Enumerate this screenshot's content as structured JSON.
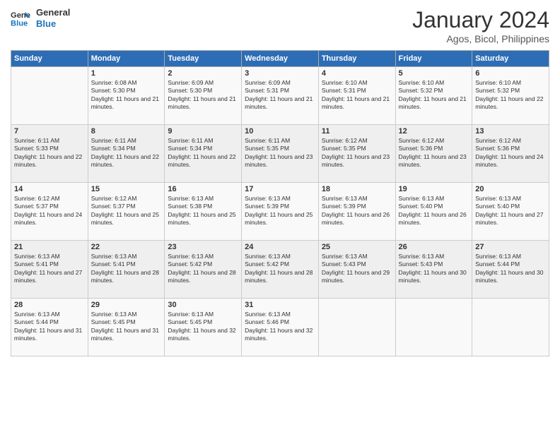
{
  "logo": {
    "line1": "General",
    "line2": "Blue"
  },
  "title": "January 2024",
  "subtitle": "Agos, Bicol, Philippines",
  "days_of_week": [
    "Sunday",
    "Monday",
    "Tuesday",
    "Wednesday",
    "Thursday",
    "Friday",
    "Saturday"
  ],
  "weeks": [
    [
      {
        "day": "",
        "sunrise": "",
        "sunset": "",
        "daylight": ""
      },
      {
        "day": "1",
        "sunrise": "Sunrise: 6:08 AM",
        "sunset": "Sunset: 5:30 PM",
        "daylight": "Daylight: 11 hours and 21 minutes."
      },
      {
        "day": "2",
        "sunrise": "Sunrise: 6:09 AM",
        "sunset": "Sunset: 5:30 PM",
        "daylight": "Daylight: 11 hours and 21 minutes."
      },
      {
        "day": "3",
        "sunrise": "Sunrise: 6:09 AM",
        "sunset": "Sunset: 5:31 PM",
        "daylight": "Daylight: 11 hours and 21 minutes."
      },
      {
        "day": "4",
        "sunrise": "Sunrise: 6:10 AM",
        "sunset": "Sunset: 5:31 PM",
        "daylight": "Daylight: 11 hours and 21 minutes."
      },
      {
        "day": "5",
        "sunrise": "Sunrise: 6:10 AM",
        "sunset": "Sunset: 5:32 PM",
        "daylight": "Daylight: 11 hours and 21 minutes."
      },
      {
        "day": "6",
        "sunrise": "Sunrise: 6:10 AM",
        "sunset": "Sunset: 5:32 PM",
        "daylight": "Daylight: 11 hours and 22 minutes."
      }
    ],
    [
      {
        "day": "7",
        "sunrise": "Sunrise: 6:11 AM",
        "sunset": "Sunset: 5:33 PM",
        "daylight": "Daylight: 11 hours and 22 minutes."
      },
      {
        "day": "8",
        "sunrise": "Sunrise: 6:11 AM",
        "sunset": "Sunset: 5:34 PM",
        "daylight": "Daylight: 11 hours and 22 minutes."
      },
      {
        "day": "9",
        "sunrise": "Sunrise: 6:11 AM",
        "sunset": "Sunset: 5:34 PM",
        "daylight": "Daylight: 11 hours and 22 minutes."
      },
      {
        "day": "10",
        "sunrise": "Sunrise: 6:11 AM",
        "sunset": "Sunset: 5:35 PM",
        "daylight": "Daylight: 11 hours and 23 minutes."
      },
      {
        "day": "11",
        "sunrise": "Sunrise: 6:12 AM",
        "sunset": "Sunset: 5:35 PM",
        "daylight": "Daylight: 11 hours and 23 minutes."
      },
      {
        "day": "12",
        "sunrise": "Sunrise: 6:12 AM",
        "sunset": "Sunset: 5:36 PM",
        "daylight": "Daylight: 11 hours and 23 minutes."
      },
      {
        "day": "13",
        "sunrise": "Sunrise: 6:12 AM",
        "sunset": "Sunset: 5:36 PM",
        "daylight": "Daylight: 11 hours and 24 minutes."
      }
    ],
    [
      {
        "day": "14",
        "sunrise": "Sunrise: 6:12 AM",
        "sunset": "Sunset: 5:37 PM",
        "daylight": "Daylight: 11 hours and 24 minutes."
      },
      {
        "day": "15",
        "sunrise": "Sunrise: 6:12 AM",
        "sunset": "Sunset: 5:37 PM",
        "daylight": "Daylight: 11 hours and 25 minutes."
      },
      {
        "day": "16",
        "sunrise": "Sunrise: 6:13 AM",
        "sunset": "Sunset: 5:38 PM",
        "daylight": "Daylight: 11 hours and 25 minutes."
      },
      {
        "day": "17",
        "sunrise": "Sunrise: 6:13 AM",
        "sunset": "Sunset: 5:39 PM",
        "daylight": "Daylight: 11 hours and 25 minutes."
      },
      {
        "day": "18",
        "sunrise": "Sunrise: 6:13 AM",
        "sunset": "Sunset: 5:39 PM",
        "daylight": "Daylight: 11 hours and 26 minutes."
      },
      {
        "day": "19",
        "sunrise": "Sunrise: 6:13 AM",
        "sunset": "Sunset: 5:40 PM",
        "daylight": "Daylight: 11 hours and 26 minutes."
      },
      {
        "day": "20",
        "sunrise": "Sunrise: 6:13 AM",
        "sunset": "Sunset: 5:40 PM",
        "daylight": "Daylight: 11 hours and 27 minutes."
      }
    ],
    [
      {
        "day": "21",
        "sunrise": "Sunrise: 6:13 AM",
        "sunset": "Sunset: 5:41 PM",
        "daylight": "Daylight: 11 hours and 27 minutes."
      },
      {
        "day": "22",
        "sunrise": "Sunrise: 6:13 AM",
        "sunset": "Sunset: 5:41 PM",
        "daylight": "Daylight: 11 hours and 28 minutes."
      },
      {
        "day": "23",
        "sunrise": "Sunrise: 6:13 AM",
        "sunset": "Sunset: 5:42 PM",
        "daylight": "Daylight: 11 hours and 28 minutes."
      },
      {
        "day": "24",
        "sunrise": "Sunrise: 6:13 AM",
        "sunset": "Sunset: 5:42 PM",
        "daylight": "Daylight: 11 hours and 28 minutes."
      },
      {
        "day": "25",
        "sunrise": "Sunrise: 6:13 AM",
        "sunset": "Sunset: 5:43 PM",
        "daylight": "Daylight: 11 hours and 29 minutes."
      },
      {
        "day": "26",
        "sunrise": "Sunrise: 6:13 AM",
        "sunset": "Sunset: 5:43 PM",
        "daylight": "Daylight: 11 hours and 30 minutes."
      },
      {
        "day": "27",
        "sunrise": "Sunrise: 6:13 AM",
        "sunset": "Sunset: 5:44 PM",
        "daylight": "Daylight: 11 hours and 30 minutes."
      }
    ],
    [
      {
        "day": "28",
        "sunrise": "Sunrise: 6:13 AM",
        "sunset": "Sunset: 5:44 PM",
        "daylight": "Daylight: 11 hours and 31 minutes."
      },
      {
        "day": "29",
        "sunrise": "Sunrise: 6:13 AM",
        "sunset": "Sunset: 5:45 PM",
        "daylight": "Daylight: 11 hours and 31 minutes."
      },
      {
        "day": "30",
        "sunrise": "Sunrise: 6:13 AM",
        "sunset": "Sunset: 5:45 PM",
        "daylight": "Daylight: 11 hours and 32 minutes."
      },
      {
        "day": "31",
        "sunrise": "Sunrise: 6:13 AM",
        "sunset": "Sunset: 5:46 PM",
        "daylight": "Daylight: 11 hours and 32 minutes."
      },
      {
        "day": "",
        "sunrise": "",
        "sunset": "",
        "daylight": ""
      },
      {
        "day": "",
        "sunrise": "",
        "sunset": "",
        "daylight": ""
      },
      {
        "day": "",
        "sunrise": "",
        "sunset": "",
        "daylight": ""
      }
    ]
  ]
}
